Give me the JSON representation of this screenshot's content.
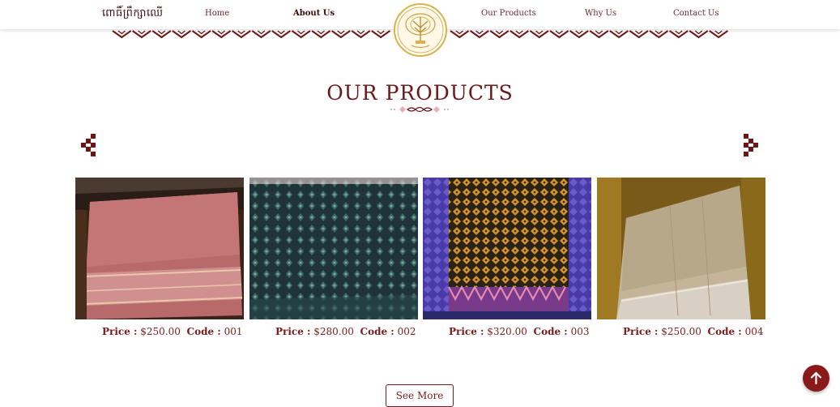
{
  "header": {
    "brand": "ពោធិ៍ព្រឹក្សាឈើ",
    "nav": [
      {
        "label": "Home"
      },
      {
        "label": "About Us"
      },
      {
        "label": "Our Products"
      },
      {
        "label": "Why Us"
      },
      {
        "label": "Contact Us"
      }
    ]
  },
  "section": {
    "title": "OUR PRODUCTS"
  },
  "products": [
    {
      "price_label": "Price :",
      "price": "$250.00",
      "code_label": "Code :",
      "code": "001"
    },
    {
      "price_label": "Price :",
      "price": "$280.00",
      "code_label": "Code :",
      "code": "002"
    },
    {
      "price_label": "Price :",
      "price": "$320.00",
      "code_label": "Code :",
      "code": "003"
    },
    {
      "price_label": "Price :",
      "price": "$250.00",
      "code_label": "Code :",
      "code": "004"
    }
  ],
  "see_more": "See More",
  "colors": {
    "brand": "#7a1c1c",
    "gold": "#d9b24a",
    "scroll_top_bg": "#8a1a1a"
  },
  "icons": [
    "prev-arrow-icon",
    "next-arrow-icon",
    "arrow-up-icon",
    "logo-tree-icon"
  ]
}
